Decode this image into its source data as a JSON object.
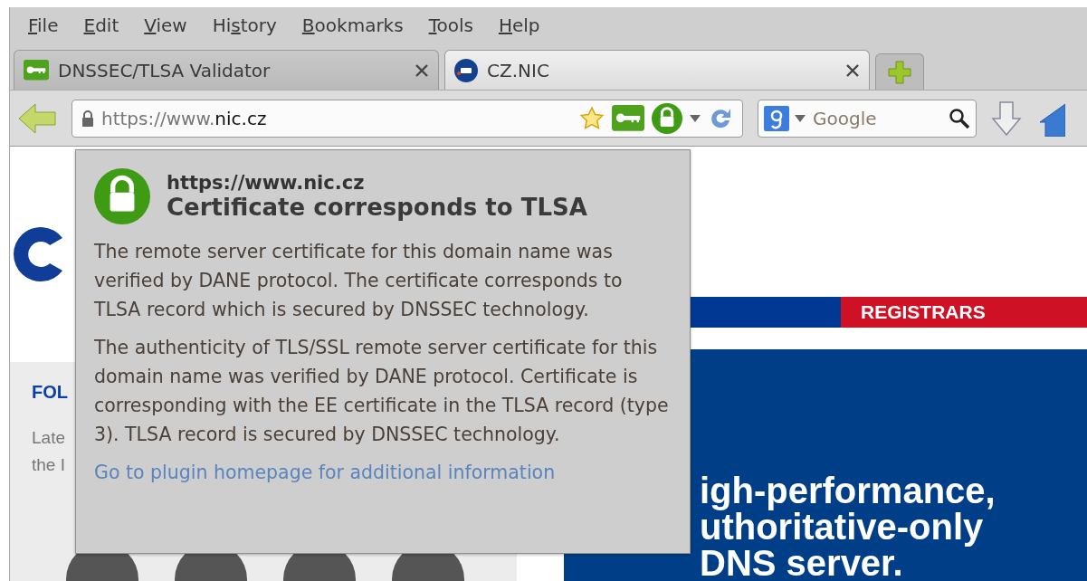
{
  "menu": [
    {
      "parts": [
        {
          "text": "F",
          "underlined": true
        },
        {
          "text": "ile",
          "underlined": false
        }
      ]
    },
    {
      "parts": [
        {
          "text": "E",
          "underlined": true
        },
        {
          "text": "dit",
          "underlined": false
        }
      ]
    },
    {
      "parts": [
        {
          "text": "V",
          "underlined": true
        },
        {
          "text": "iew",
          "underlined": false
        }
      ]
    },
    {
      "parts": [
        {
          "text": "Hi",
          "underlined": false
        },
        {
          "text": "s",
          "underlined": true
        },
        {
          "text": "tory",
          "underlined": false
        }
      ]
    },
    {
      "parts": [
        {
          "text": "B",
          "underlined": true
        },
        {
          "text": "ookmarks",
          "underlined": false
        }
      ]
    },
    {
      "parts": [
        {
          "text": "T",
          "underlined": true
        },
        {
          "text": "ools",
          "underlined": false
        }
      ]
    },
    {
      "parts": [
        {
          "text": "H",
          "underlined": true
        },
        {
          "text": "elp",
          "underlined": false
        }
      ]
    }
  ],
  "tabs": [
    {
      "title": "DNSSEC/TLSA Validator",
      "kind": "key",
      "selected": false
    },
    {
      "title": "CZ.NIC",
      "kind": "badge",
      "selected": true
    }
  ],
  "address_bar": {
    "prefix": "https://www.",
    "domain": "nic.cz"
  },
  "search": {
    "placeholder": "Google"
  },
  "page": {
    "sidebar_heading": "FOL",
    "sidebar_lines": [
      "Late",
      "the I"
    ],
    "nav": [
      {
        "color": "#003893"
      },
      {
        "label": "REGISTRARS",
        "color": "#cf1126"
      }
    ],
    "hero_lines": [
      "igh-performance,",
      "uthoritative-only",
      "DNS server."
    ]
  },
  "popup": {
    "url": "https://www.nic.cz",
    "title": "Certificate corresponds to TLSA",
    "paragraphs": [
      "The remote server certificate for this domain name was verified by DANE protocol. The certificate corresponds to TLSA record which is secured by DNSSEC technology.",
      "The authenticity of TLS/SSL remote server certificate for this domain name was verified by DANE protocol. Certificate is corresponding with the EE certificate in the TLSA record (type 3). TLSA record is secured by DNSSEC technology."
    ],
    "link": "Go to plugin homepage for additional information"
  }
}
